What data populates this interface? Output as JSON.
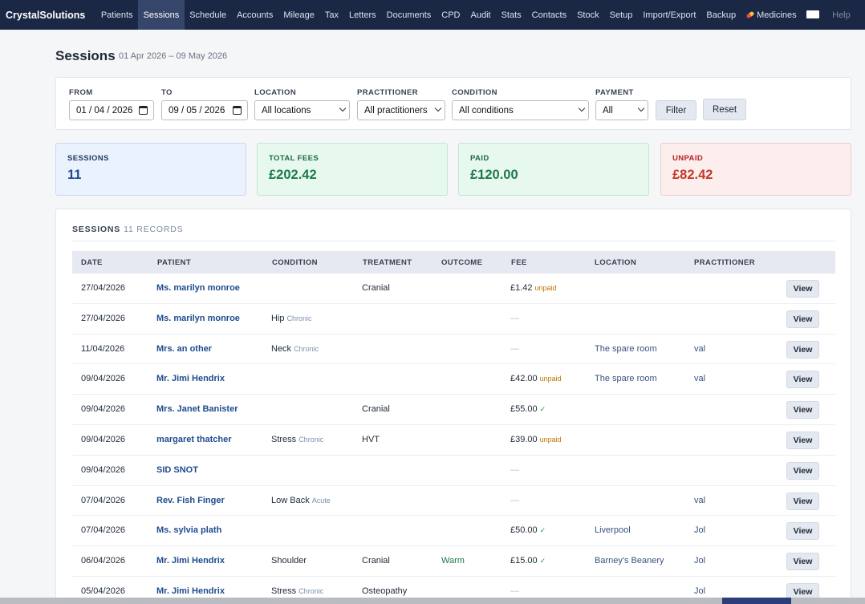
{
  "nav": {
    "brand": "CrystalSolutions",
    "items": [
      {
        "label": "Patients",
        "active": false
      },
      {
        "label": "Sessions",
        "active": true
      },
      {
        "label": "Schedule",
        "active": false
      },
      {
        "label": "Accounts",
        "active": false
      },
      {
        "label": "Mileage",
        "active": false
      },
      {
        "label": "Tax",
        "active": false
      },
      {
        "label": "Letters",
        "active": false
      },
      {
        "label": "Documents",
        "active": false
      },
      {
        "label": "CPD",
        "active": false
      },
      {
        "label": "Audit",
        "active": false
      },
      {
        "label": "Stats",
        "active": false
      },
      {
        "label": "Contacts",
        "active": false
      },
      {
        "label": "Stock",
        "active": false
      },
      {
        "label": "Setup",
        "active": false
      },
      {
        "label": "Import/Export",
        "active": false
      },
      {
        "label": "Backup",
        "active": false
      },
      {
        "label": "Medicines",
        "active": false,
        "icon": "pill-icon"
      }
    ],
    "help": "Help"
  },
  "page": {
    "title": "Sessions",
    "range": "01 Apr 2026 – 09 May 2026"
  },
  "filters": {
    "from_label": "FROM",
    "from_value": "01 / 04 / 2026",
    "to_label": "TO",
    "to_value": "09 / 05 / 2026",
    "location_label": "LOCATION",
    "location_value": "All locations",
    "practitioner_label": "PRACTITIONER",
    "practitioner_value": "All practitioners",
    "condition_label": "CONDITION",
    "condition_value": "All conditions",
    "payment_label": "PAYMENT",
    "payment_value": "All",
    "filter_button": "Filter",
    "reset_button": "Reset"
  },
  "stats": {
    "sessions": {
      "label": "SESSIONS",
      "value": "11"
    },
    "total_fees": {
      "label": "TOTAL FEES",
      "value": "£202.42"
    },
    "paid": {
      "label": "PAID",
      "value": "£120.00"
    },
    "unpaid": {
      "label": "UNPAID",
      "value": "£82.42"
    }
  },
  "table": {
    "heading": "SESSIONS",
    "count": "11 RECORDS",
    "columns": {
      "date": "DATE",
      "patient": "PATIENT",
      "condition": "CONDITION",
      "treatment": "TREATMENT",
      "outcome": "OUTCOME",
      "fee": "FEE",
      "location": "LOCATION",
      "practitioner": "PRACTITIONER"
    },
    "view_label": "View",
    "rows": [
      {
        "date": "27/04/2026",
        "patient": "Ms. marilyn monroe",
        "condition": "",
        "condition_tag": "",
        "treatment": "Cranial",
        "outcome": "",
        "fee": "£1.42",
        "fee_status": "unpaid",
        "location": "",
        "practitioner": ""
      },
      {
        "date": "27/04/2026",
        "patient": "Ms. marilyn monroe",
        "condition": "Hip",
        "condition_tag": "Chronic",
        "treatment": "",
        "outcome": "",
        "fee": "—",
        "fee_status": "",
        "location": "",
        "practitioner": ""
      },
      {
        "date": "11/04/2026",
        "patient": "Mrs. an other",
        "condition": "Neck",
        "condition_tag": "Chronic",
        "treatment": "",
        "outcome": "",
        "fee": "—",
        "fee_status": "",
        "location": "The spare room",
        "practitioner": "val"
      },
      {
        "date": "09/04/2026",
        "patient": "Mr. Jimi Hendrix",
        "condition": "",
        "condition_tag": "",
        "treatment": "",
        "outcome": "",
        "fee": "£42.00",
        "fee_status": "unpaid",
        "location": "The spare room",
        "practitioner": "val"
      },
      {
        "date": "09/04/2026",
        "patient": "Mrs. Janet Banister",
        "condition": "",
        "condition_tag": "",
        "treatment": "Cranial",
        "outcome": "",
        "fee": "£55.00",
        "fee_status": "✓",
        "location": "",
        "practitioner": ""
      },
      {
        "date": "09/04/2026",
        "patient": "margaret thatcher",
        "condition": "Stress",
        "condition_tag": "Chronic",
        "treatment": "HVT",
        "outcome": "",
        "fee": "£39.00",
        "fee_status": "unpaid",
        "location": "",
        "practitioner": ""
      },
      {
        "date": "09/04/2026",
        "patient": "SID SNOT",
        "condition": "",
        "condition_tag": "",
        "treatment": "",
        "outcome": "",
        "fee": "—",
        "fee_status": "",
        "location": "",
        "practitioner": ""
      },
      {
        "date": "07/04/2026",
        "patient": "Rev. Fish Finger",
        "condition": "Low Back",
        "condition_tag": "Acute",
        "treatment": "",
        "outcome": "",
        "fee": "—",
        "fee_status": "",
        "location": "",
        "practitioner": "val"
      },
      {
        "date": "07/04/2026",
        "patient": "Ms. sylvia plath",
        "condition": "",
        "condition_tag": "",
        "treatment": "",
        "outcome": "",
        "fee": "£50.00",
        "fee_status": "✓",
        "location": "Liverpool",
        "practitioner": "Jol"
      },
      {
        "date": "06/04/2026",
        "patient": "Mr. Jimi Hendrix",
        "condition": "Shoulder",
        "condition_tag": "",
        "treatment": "Cranial",
        "outcome": "Warm",
        "fee": "£15.00",
        "fee_status": "✓",
        "location": "Barney's Beanery",
        "practitioner": "Jol"
      },
      {
        "date": "05/04/2026",
        "patient": "Mr. Jimi Hendrix",
        "condition": "Stress",
        "condition_tag": "Chronic",
        "treatment": "Osteopathy",
        "outcome": "",
        "fee": "—",
        "fee_status": "",
        "location": "",
        "practitioner": "Jol"
      }
    ]
  },
  "colors": {
    "nav_bg": "#1b2845",
    "accent": "#1e4b8f",
    "paid": "#1d7a4a",
    "unpaid": "#c0392b"
  }
}
